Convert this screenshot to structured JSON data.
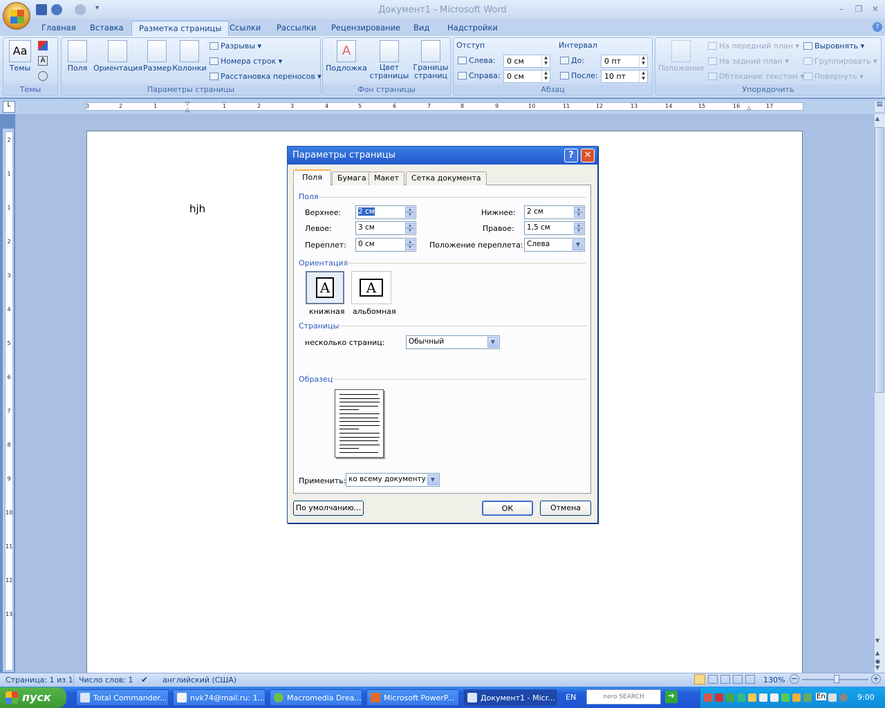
{
  "window": {
    "title": "Документ1 - Microsoft Word"
  },
  "tabs": [
    "Главная",
    "Вставка",
    "Разметка страницы",
    "Ссылки",
    "Рассылки",
    "Рецензирование",
    "Вид",
    "Надстройки"
  ],
  "ribbon": {
    "themes": {
      "button": "Темы",
      "group": "Темы"
    },
    "page_setup": {
      "buttons": [
        "Поля",
        "Ориентация",
        "Размер",
        "Колонки"
      ],
      "breaks": "Разрывы",
      "line_numbers": "Номера строк",
      "hyphenation": "Расстановка переносов",
      "group": "Параметры страницы"
    },
    "background": {
      "watermark": "Подложка",
      "page_color": "Цвет страницы",
      "page_borders": "Границы страниц",
      "group": "Фон страницы"
    },
    "paragraph": {
      "indent_label": "Отступ",
      "left_label": "Слева:",
      "left_value": "0 см",
      "right_label": "Справа:",
      "right_value": "0 см",
      "spacing_label": "Интервал",
      "before_label": "До:",
      "before_value": "0 пт",
      "after_label": "После:",
      "after_value": "10 пт",
      "group": "Абзац"
    },
    "arrange": {
      "position": "Положение",
      "bring_front": "На передний план",
      "send_back": "На задний план",
      "wrap": "Обтекание текстом",
      "align": "Выровнять",
      "group_btn": "Группировать",
      "rotate": "Повернуть",
      "group": "Упорядочить"
    }
  },
  "ruler": {
    "marks": [
      "3",
      "2",
      "1",
      "1",
      "2",
      "3",
      "4",
      "5",
      "6",
      "7",
      "8",
      "9",
      "10",
      "11",
      "12",
      "13",
      "14",
      "15",
      "16",
      "17"
    ]
  },
  "vruler": {
    "marks": [
      "2",
      "1",
      "1",
      "2",
      "3",
      "4",
      "5",
      "6",
      "7",
      "8",
      "9",
      "10",
      "11",
      "12",
      "13"
    ]
  },
  "document": {
    "text": "hjh"
  },
  "dialog": {
    "title": "Параметры страницы",
    "help": "?",
    "tabs": [
      "Поля",
      "Бумага",
      "Макет",
      "Сетка документа"
    ],
    "margins": {
      "section": "Поля",
      "top_label": "Верхнее:",
      "top_value": "2 см",
      "bottom_label": "Нижнее:",
      "bottom_value": "2 см",
      "left_label": "Левое:",
      "left_value": "3 см",
      "right_label": "Правое:",
      "right_value": "1,5 см",
      "gutter_label": "Переплет:",
      "gutter_value": "0 см",
      "gutter_pos_label": "Положение переплета:",
      "gutter_pos_value": "Слева"
    },
    "orientation": {
      "section": "Ориентация",
      "portrait": "книжная",
      "landscape": "альбомная",
      "glyph": "A"
    },
    "pages": {
      "section": "Страницы",
      "multiple_label": "несколько страниц:",
      "multiple_value": "Обычный"
    },
    "preview": {
      "section": "Образец"
    },
    "apply": {
      "label": "Применить:",
      "value": "ко всему документу"
    },
    "buttons": {
      "default": "По умолчанию...",
      "ok": "ОК",
      "cancel": "Отмена"
    }
  },
  "status": {
    "page": "Страница: 1 из 1",
    "words": "Число слов: 1",
    "language": "английский (США)",
    "zoom": "130%"
  },
  "taskbar": {
    "start": "пуск",
    "tasks": [
      "Total Commander...",
      "nvk74@mail.ru: 1...",
      "Macromedia Drea...",
      "Microsoft PowerP...",
      "Документ1 - Micr..."
    ],
    "lang": "EN",
    "nero": "nero SEARCH",
    "tray_lang": "En",
    "clock": "9:00"
  },
  "colors": {
    "accent": "#15428b",
    "dialog_title": "#2458c9",
    "taskbar": "#245edb",
    "start": "#3a9a30"
  }
}
